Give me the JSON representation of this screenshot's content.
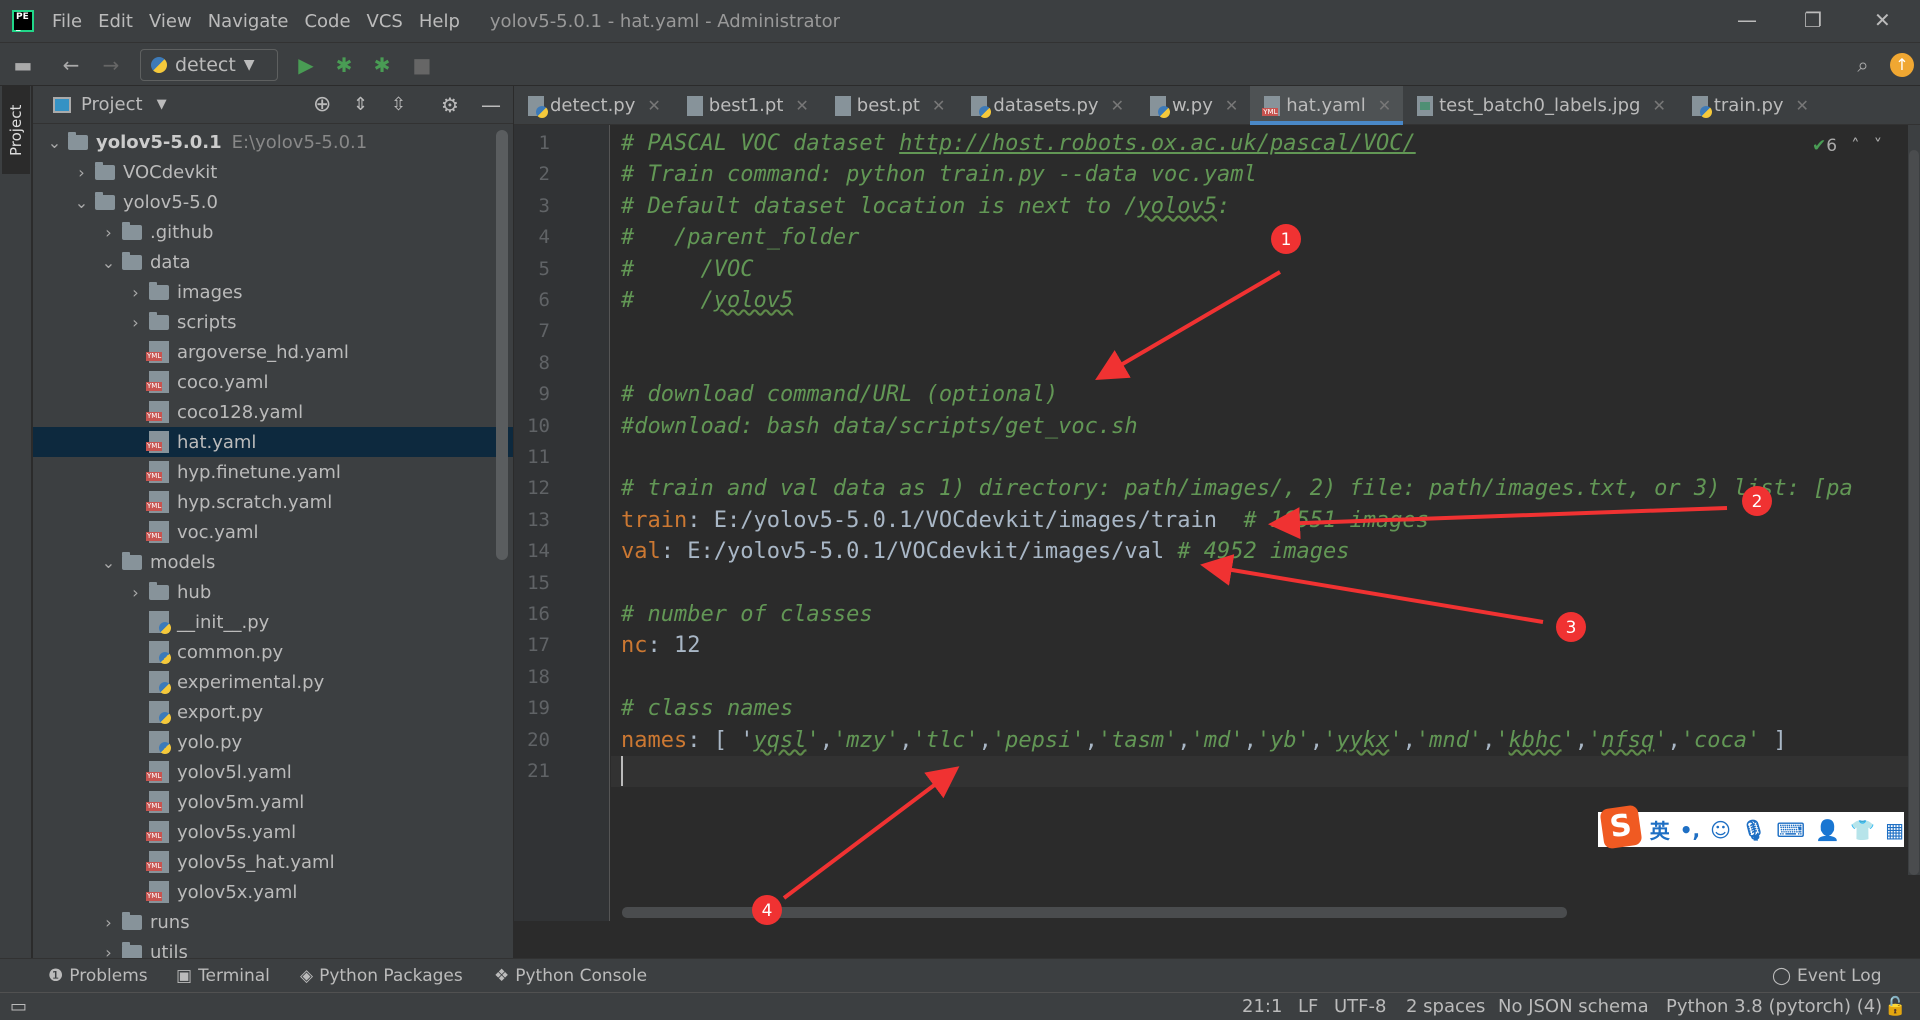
{
  "app": {
    "menu": [
      "File",
      "Edit",
      "View",
      "Navigate",
      "Code",
      "VCS",
      "Help"
    ],
    "window_title": "yolov5-5.0.1 - hat.yaml - Administrator"
  },
  "toolbar": {
    "run_config": "detect"
  },
  "project": {
    "side_tab": "Project",
    "header": "Project",
    "tree": [
      {
        "label": "yolov5-5.0.1",
        "hint": "E:\\yolov5-5.0.1",
        "level": 0,
        "type": "folder",
        "expanded": true,
        "bold": true
      },
      {
        "label": "VOCdevkit",
        "level": 1,
        "type": "folder",
        "expanded": false
      },
      {
        "label": "yolov5-5.0",
        "level": 1,
        "type": "folder",
        "expanded": true
      },
      {
        "label": ".github",
        "level": 2,
        "type": "folder",
        "expanded": false
      },
      {
        "label": "data",
        "level": 2,
        "type": "folder",
        "expanded": true
      },
      {
        "label": "images",
        "level": 3,
        "type": "folder",
        "expanded": false
      },
      {
        "label": "scripts",
        "level": 3,
        "type": "folder",
        "expanded": false
      },
      {
        "label": "argoverse_hd.yaml",
        "level": 3,
        "type": "yaml"
      },
      {
        "label": "coco.yaml",
        "level": 3,
        "type": "yaml"
      },
      {
        "label": "coco128.yaml",
        "level": 3,
        "type": "yaml"
      },
      {
        "label": "hat.yaml",
        "level": 3,
        "type": "yaml",
        "selected": true
      },
      {
        "label": "hyp.finetune.yaml",
        "level": 3,
        "type": "yaml"
      },
      {
        "label": "hyp.scratch.yaml",
        "level": 3,
        "type": "yaml"
      },
      {
        "label": "voc.yaml",
        "level": 3,
        "type": "yaml"
      },
      {
        "label": "models",
        "level": 2,
        "type": "folder",
        "expanded": true
      },
      {
        "label": "hub",
        "level": 3,
        "type": "folder",
        "expanded": false
      },
      {
        "label": "__init__.py",
        "level": 3,
        "type": "py"
      },
      {
        "label": "common.py",
        "level": 3,
        "type": "py"
      },
      {
        "label": "experimental.py",
        "level": 3,
        "type": "py"
      },
      {
        "label": "export.py",
        "level": 3,
        "type": "py"
      },
      {
        "label": "yolo.py",
        "level": 3,
        "type": "py"
      },
      {
        "label": "yolov5l.yaml",
        "level": 3,
        "type": "yaml"
      },
      {
        "label": "yolov5m.yaml",
        "level": 3,
        "type": "yaml"
      },
      {
        "label": "yolov5s.yaml",
        "level": 3,
        "type": "yaml"
      },
      {
        "label": "yolov5s_hat.yaml",
        "level": 3,
        "type": "yaml"
      },
      {
        "label": "yolov5x.yaml",
        "level": 3,
        "type": "yaml"
      },
      {
        "label": "runs",
        "level": 2,
        "type": "folder",
        "expanded": false
      },
      {
        "label": "utils",
        "level": 2,
        "type": "folder",
        "expanded": false
      }
    ]
  },
  "tabs": [
    {
      "label": "detect.py",
      "icon": "py"
    },
    {
      "label": "best1.pt",
      "icon": "file"
    },
    {
      "label": "best.pt",
      "icon": "file"
    },
    {
      "label": "datasets.py",
      "icon": "py"
    },
    {
      "label": "w.py",
      "icon": "py"
    },
    {
      "label": "hat.yaml",
      "icon": "ym",
      "active": true
    },
    {
      "label": "test_batch0_labels.jpg",
      "icon": "img"
    },
    {
      "label": "train.py",
      "icon": "py"
    }
  ],
  "editor": {
    "inspection_count": "6",
    "current_line": 21,
    "lines": [
      [
        [
          "comment",
          "# PASCAL VOC dataset "
        ],
        [
          "url",
          "http://host.robots.ox.ac.uk/pascal/VOC/"
        ]
      ],
      [
        [
          "comment",
          "# Train command: python train.py --data voc.yaml"
        ]
      ],
      [
        [
          "comment",
          "# Default dataset location is next to /"
        ],
        [
          "comment typo",
          "yolov5"
        ],
        [
          "comment",
          ":"
        ]
      ],
      [
        [
          "comment",
          "#   /parent_folder"
        ]
      ],
      [
        [
          "comment",
          "#     /VOC"
        ]
      ],
      [
        [
          "comment",
          "#     /"
        ],
        [
          "comment typo",
          "yolov5"
        ]
      ],
      [],
      [],
      [
        [
          "comment",
          "# download command/URL (optional)"
        ]
      ],
      [
        [
          "comment",
          "#download: bash data/scripts/get_voc.sh"
        ]
      ],
      [],
      [
        [
          "comment",
          "# train and val data as 1) directory: path/images/, 2) file: path/images.txt, or 3) list: [pa"
        ]
      ],
      [
        [
          "key",
          "train"
        ],
        [
          "val",
          ": E:/yolov5-5.0.1/VOCdevkit/images/train  "
        ],
        [
          "comment",
          "# 16551 images"
        ]
      ],
      [
        [
          "key",
          "val"
        ],
        [
          "val",
          ": E:/yolov5-5.0.1/VOCdevkit/images/val "
        ],
        [
          "comment",
          "# 4952 images"
        ]
      ],
      [],
      [
        [
          "comment",
          "# number of classes"
        ]
      ],
      [
        [
          "key",
          "nc"
        ],
        [
          "val",
          ": 12"
        ]
      ],
      [],
      [
        [
          "comment",
          "# class names"
        ]
      ],
      [
        [
          "key",
          "names"
        ],
        [
          "val",
          ": [ '"
        ],
        [
          "comment typo",
          "yqsl"
        ],
        [
          "comment",
          "'"
        ],
        [
          "val",
          ","
        ],
        [
          "comment",
          "'mzy'"
        ],
        [
          "val",
          ","
        ],
        [
          "comment",
          "'tlc'"
        ],
        [
          "val",
          ","
        ],
        [
          "comment",
          "'pepsi'"
        ],
        [
          "val",
          ","
        ],
        [
          "comment",
          "'tasm'"
        ],
        [
          "val",
          ","
        ],
        [
          "comment",
          "'md'"
        ],
        [
          "val",
          ","
        ],
        [
          "comment",
          "'yb'"
        ],
        [
          "val",
          ","
        ],
        [
          "comment",
          "'"
        ],
        [
          "comment typo",
          "yykx"
        ],
        [
          "comment",
          "'"
        ],
        [
          "val",
          ","
        ],
        [
          "comment",
          "'mnd'"
        ],
        [
          "val",
          ","
        ],
        [
          "comment",
          "'"
        ],
        [
          "comment typo",
          "kbhc"
        ],
        [
          "comment",
          "'"
        ],
        [
          "val",
          ","
        ],
        [
          "comment",
          "'"
        ],
        [
          "comment typo",
          "nfsq"
        ],
        [
          "comment",
          "'"
        ],
        [
          "val",
          ","
        ],
        [
          "comment",
          "'coca'"
        ],
        [
          "val",
          " ]"
        ]
      ],
      []
    ]
  },
  "annotations": [
    "1",
    "2",
    "3",
    "4"
  ],
  "ime": {
    "lang": "英",
    "punct": "•,"
  },
  "toolwindows": {
    "problems": "Problems",
    "terminal": "Terminal",
    "packages": "Python Packages",
    "console": "Python Console",
    "event_log": "Event Log"
  },
  "status": {
    "position": "21:1",
    "line_sep": "LF",
    "encoding": "UTF-8",
    "indent": "2 spaces",
    "schema": "No JSON schema",
    "interpreter": "Python 3.8 (pytorch) (4)"
  },
  "colors": {
    "accent": "#4a88c7",
    "comment": "#629755",
    "key": "#cc7832",
    "annotation": "#f03232"
  }
}
